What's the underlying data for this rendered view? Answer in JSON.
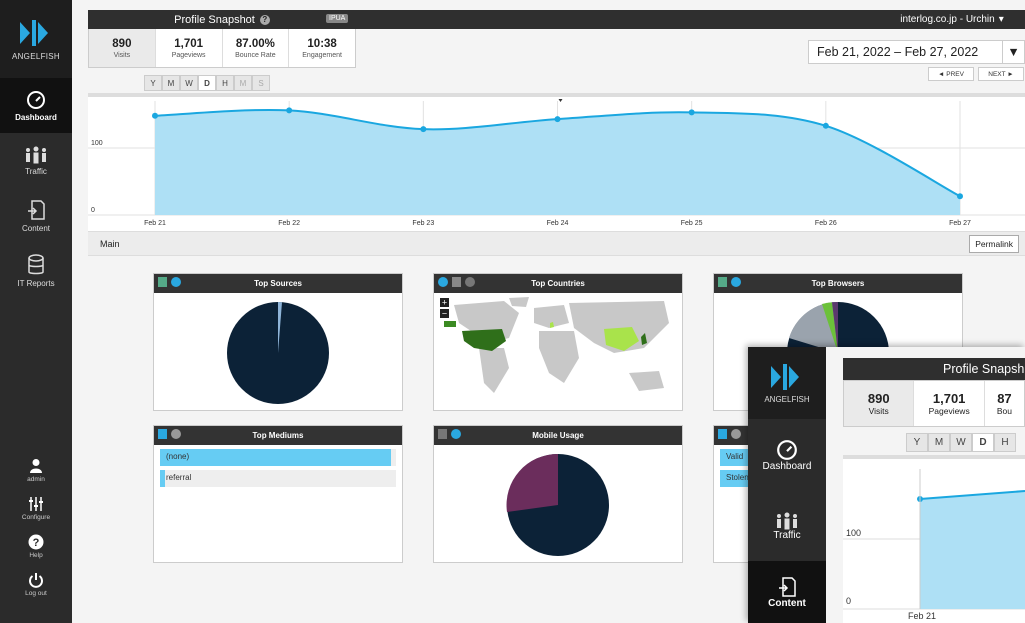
{
  "app": {
    "brand": "ANGELFISH"
  },
  "sidebar": {
    "items": [
      {
        "label": "Dashboard",
        "icon": "dashboard-icon"
      },
      {
        "label": "Traffic",
        "icon": "traffic-icon"
      },
      {
        "label": "Content",
        "icon": "content-icon"
      },
      {
        "label": "IT Reports",
        "icon": "database-icon"
      }
    ],
    "bottom": [
      {
        "label": "admin",
        "icon": "user-icon"
      },
      {
        "label": "Configure",
        "icon": "sliders-icon"
      },
      {
        "label": "Help",
        "icon": "help-icon"
      },
      {
        "label": "Log out",
        "icon": "power-icon"
      }
    ]
  },
  "header": {
    "title": "Profile Snapshot",
    "badge": "IPUA",
    "profile": "interlog.co.jp - Urchin"
  },
  "metrics": [
    {
      "value": "890",
      "label": "Visits"
    },
    {
      "value": "1,701",
      "label": "Pageviews"
    },
    {
      "value": "87.00%",
      "label": "Bounce Rate"
    },
    {
      "value": "10:38",
      "label": "Engagement"
    }
  ],
  "granularity": [
    "Y",
    "M",
    "W",
    "D",
    "H",
    "M",
    "S"
  ],
  "date": {
    "range": "Feb 21, 2022 – Feb 27, 2022",
    "prev": "◄ PREV",
    "next": "NEXT ►"
  },
  "chart_data": {
    "type": "area",
    "x": [
      "Feb 21",
      "Feb 22",
      "Feb 23",
      "Feb 24",
      "Feb 25",
      "Feb 26",
      "Feb 27"
    ],
    "series": [
      {
        "values": [
          148,
          156,
          128,
          143,
          153,
          133,
          28
        ]
      }
    ],
    "ylim": [
      0,
      170
    ],
    "yticks": [
      "0",
      "100"
    ],
    "grid": true,
    "color": "#aee0f5",
    "line_color": "#1aa7e0"
  },
  "mainbar": {
    "label": "Main",
    "permalink": "Permalink"
  },
  "widgets": {
    "sources": {
      "title": "Top Sources"
    },
    "countries": {
      "title": "Top Countries"
    },
    "browsers": {
      "title": "Top Browsers"
    },
    "mediums": {
      "title": "Top Mediums",
      "rows": [
        {
          "label": "(none)",
          "share": 0.98
        },
        {
          "label": "referral",
          "share": 0.02
        }
      ]
    },
    "mobile": {
      "title": "Mobile Usage"
    },
    "fourth": {
      "rows": [
        {
          "label": "Valid"
        },
        {
          "label": "Stolen"
        }
      ]
    }
  },
  "overlay": {
    "title": "Profile Snapsh",
    "metrics": [
      {
        "value": "890",
        "label": "Visits"
      },
      {
        "value": "1,701",
        "label": "Pageviews"
      },
      {
        "value": "87",
        "label": "Bou"
      }
    ],
    "granularity": [
      "Y",
      "M",
      "W",
      "D",
      "H"
    ],
    "nav": [
      "Dashboard",
      "Traffic",
      "Content"
    ],
    "ytick100": "100",
    "ytick0": "0",
    "xlabel": "Feb 21"
  }
}
